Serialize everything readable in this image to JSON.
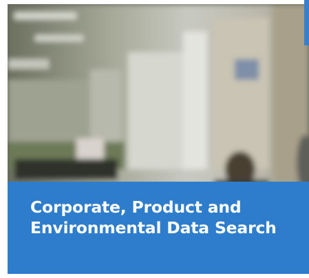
{
  "tile": {
    "title": "Corporate, Product and Environmental Data Search",
    "photo": "blurred-office-background-image"
  },
  "colors": {
    "caption_background": "#2e7dcc",
    "caption_text": "#ffffff",
    "accent": "#3a7fcb"
  }
}
